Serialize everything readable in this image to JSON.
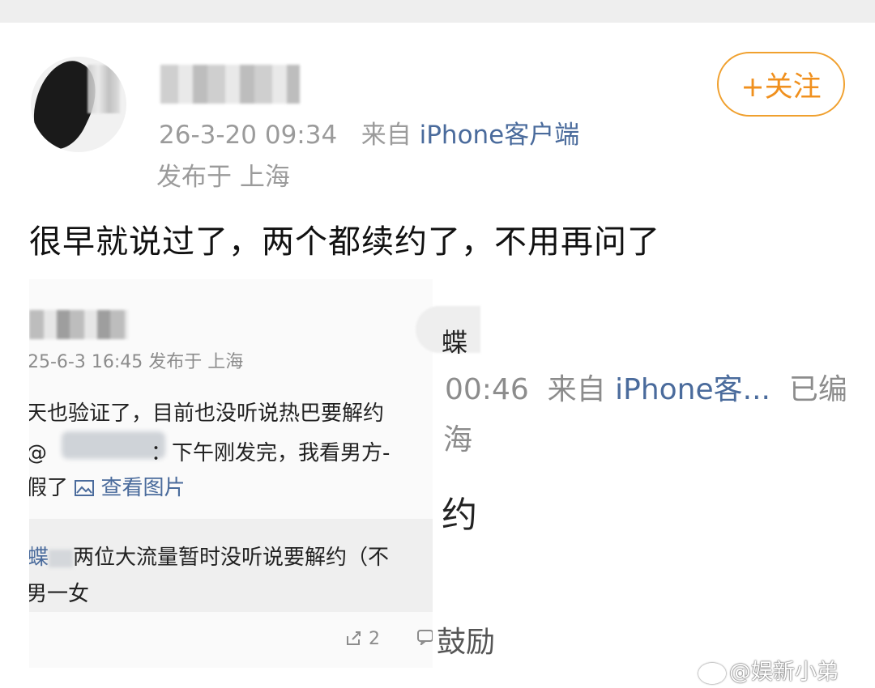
{
  "post": {
    "timestamp": "26-3-20 09:34",
    "source_prefix": "来自",
    "source": "iPhone客户端",
    "location": "发布于 上海",
    "follow_label": "+关注",
    "text": "很早就说过了，两个都续约了，不用再问了"
  },
  "embedded": {
    "meta": "25-6-3 16:45  发布于 上海",
    "line1": "天也验证了，目前也没听说热巴要解约",
    "line2_prefix": "@",
    "line2_suffix": "：下午刚发完，我看男方-",
    "line3_prefix": "假了",
    "line3_link": "查看图片",
    "quote_name": "蝶",
    "quote_line1": "两位大流量暂时没听说要解约（不",
    "quote_line2": "男一女",
    "share_count": "2"
  },
  "right_crop": {
    "name": "蝶",
    "time": "00:46",
    "source_prefix": "来自",
    "source": "iPhone客...",
    "edited": "已编",
    "location": "海",
    "big_text": "约",
    "encourage": "鼓励"
  },
  "watermark": "@娱新小弟"
}
